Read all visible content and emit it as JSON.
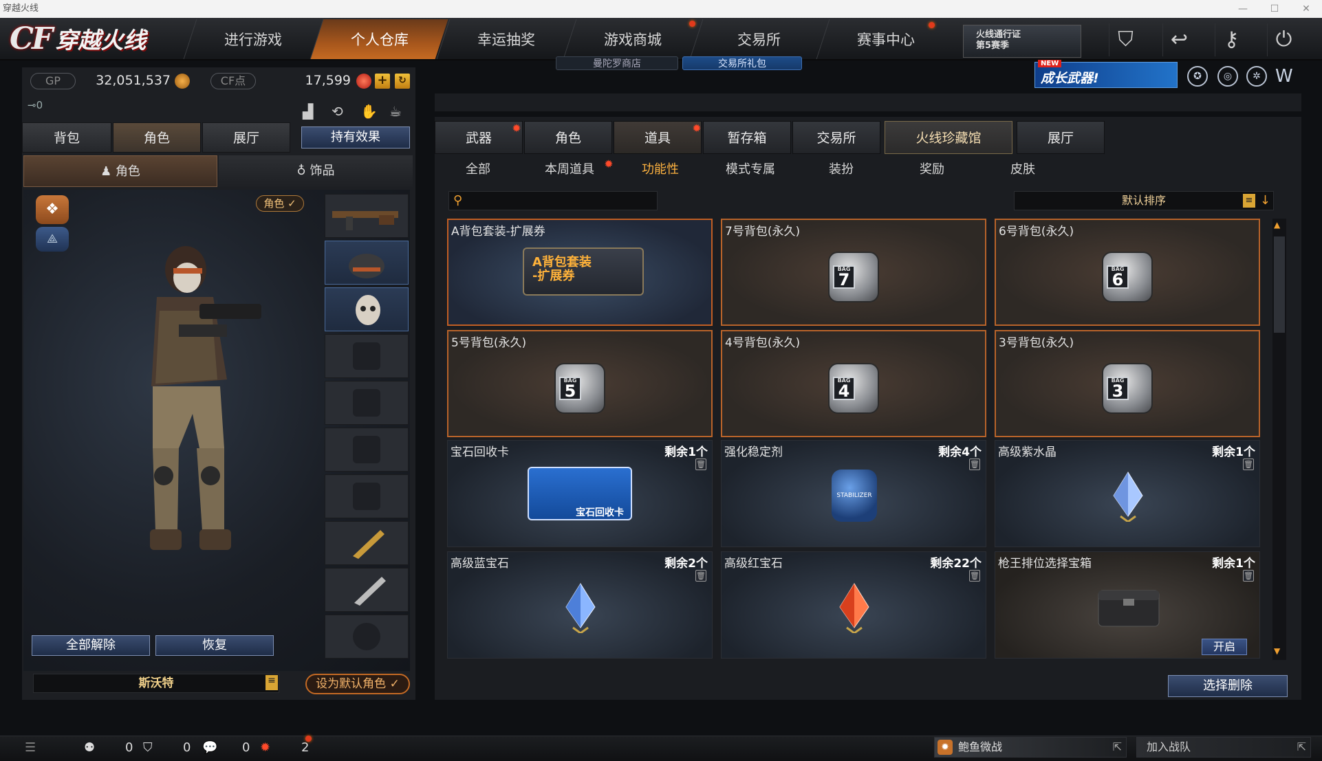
{
  "window": {
    "title": "穿越火线"
  },
  "logo": {
    "cf": "CF",
    "name": "穿越火线"
  },
  "nav": {
    "tabs": [
      "进行游戏",
      "个人仓库",
      "幸运抽奖",
      "游戏商城",
      "交易所",
      "赛事中心"
    ],
    "subpills": [
      "曼陀罗商店",
      "交易所礼包"
    ],
    "pass_line1": "火线通行证",
    "pass_line2": "第5赛季",
    "new_badge": "NEW",
    "new_banner": "成长武器!"
  },
  "currency": {
    "gp_label": "GP",
    "gp_value": "32,051,537",
    "cf_label": "CF点",
    "cf_value": "17,599",
    "key_count": "0"
  },
  "left": {
    "tabs": [
      "背包",
      "角色",
      "展厅"
    ],
    "effect_button": "持有效果",
    "subtabs": [
      "角色",
      "饰品"
    ],
    "role_tag": "角色 ✓",
    "release_all": "全部解除",
    "restore": "恢复",
    "char_name": "斯沃特",
    "set_default": "设为默认角色"
  },
  "right": {
    "main_tabs": [
      "武器",
      "角色",
      "道具",
      "暂存箱",
      "交易所",
      "火线珍藏馆",
      "展厅"
    ],
    "sub_tabs": [
      "全部",
      "本周道具",
      "功能性",
      "模式专属",
      "装扮",
      "奖励",
      "皮肤"
    ],
    "search_placeholder": "",
    "sort_label": "默认排序",
    "select_delete": "选择删除",
    "items": [
      {
        "name": "A背包套装-扩展券",
        "qty": "",
        "art": "A背包套装\n-扩展券"
      },
      {
        "name": "7号背包(永久)",
        "qty": "",
        "bag": "7"
      },
      {
        "name": "6号背包(永久)",
        "qty": "",
        "bag": "6"
      },
      {
        "name": "5号背包(永久)",
        "qty": "",
        "bag": "5"
      },
      {
        "name": "4号背包(永久)",
        "qty": "",
        "bag": "4"
      },
      {
        "name": "3号背包(永久)",
        "qty": "",
        "bag": "3"
      },
      {
        "name": "宝石回收卡",
        "qty": "剩余1个",
        "art": "宝石回收卡"
      },
      {
        "name": "强化稳定剂",
        "qty": "剩余4个",
        "art": "STABILIZER"
      },
      {
        "name": "高级紫水晶",
        "qty": "剩余1个"
      },
      {
        "name": "高级蓝宝石",
        "qty": "剩余2个"
      },
      {
        "name": "高级红宝石",
        "qty": "剩余22个"
      },
      {
        "name": "枪王排位选择宝箱",
        "qty": "剩余1个",
        "open": "开启"
      }
    ],
    "bag_small": "BAG"
  },
  "bottom": {
    "counts": [
      "0",
      "0",
      "0",
      "2"
    ],
    "team_link": "鲍鱼微战",
    "join_team": "加入战队"
  },
  "colors": {
    "accent": "#c56a22",
    "gold": "#ffb340",
    "blue": "#3b4d70"
  }
}
